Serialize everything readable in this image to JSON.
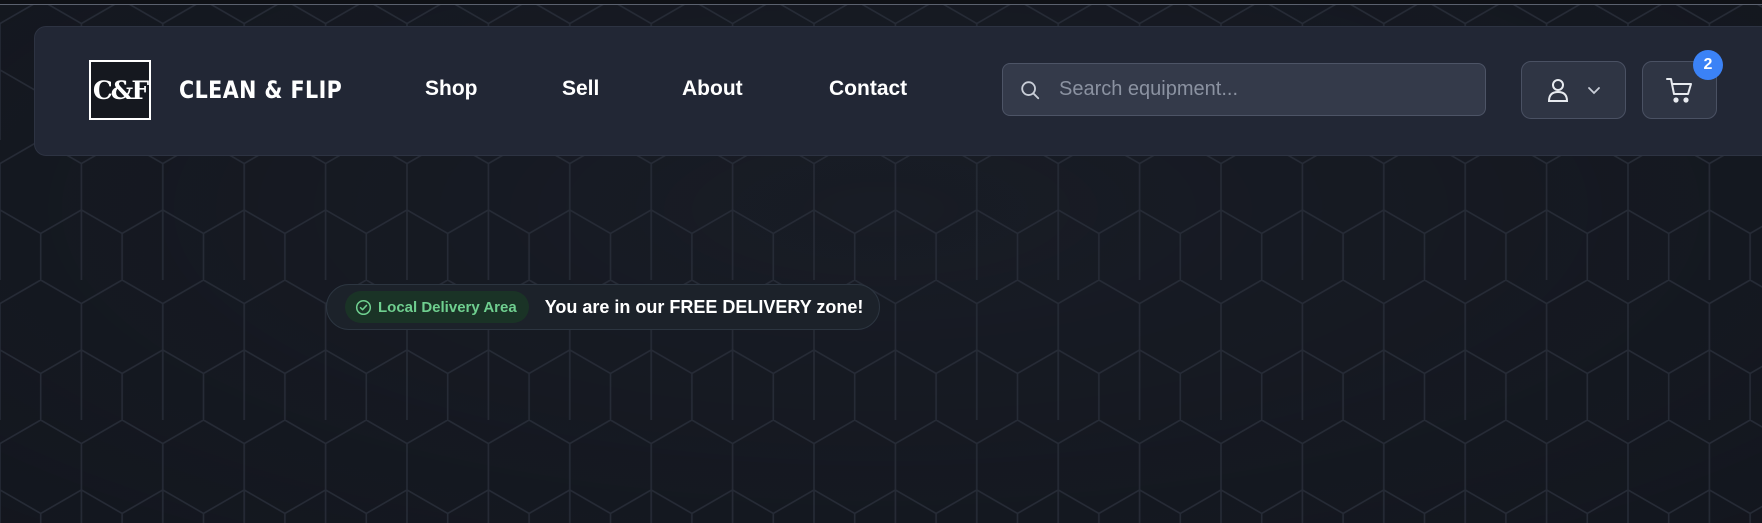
{
  "brand": {
    "logo_text": "C&F",
    "name": "CLEAN & FLIP"
  },
  "nav": {
    "items": [
      {
        "label": "Shop"
      },
      {
        "label": "Sell"
      },
      {
        "label": "About"
      },
      {
        "label": "Contact"
      }
    ]
  },
  "search": {
    "placeholder": "Search equipment...",
    "value": "",
    "icon": "search-icon"
  },
  "account": {
    "icon": "user-icon",
    "dropdown_icon": "chevron-down-icon"
  },
  "cart": {
    "icon": "cart-icon",
    "count": "2"
  },
  "delivery": {
    "tag_label": "Local Delivery Area",
    "message": "You are in our FREE DELIVERY zone!",
    "icon": "check-circle-icon"
  },
  "colors": {
    "background": "#181c25",
    "header": "#222735",
    "badge": "#3b82f6",
    "delivery_green": "#6fcf8f"
  }
}
